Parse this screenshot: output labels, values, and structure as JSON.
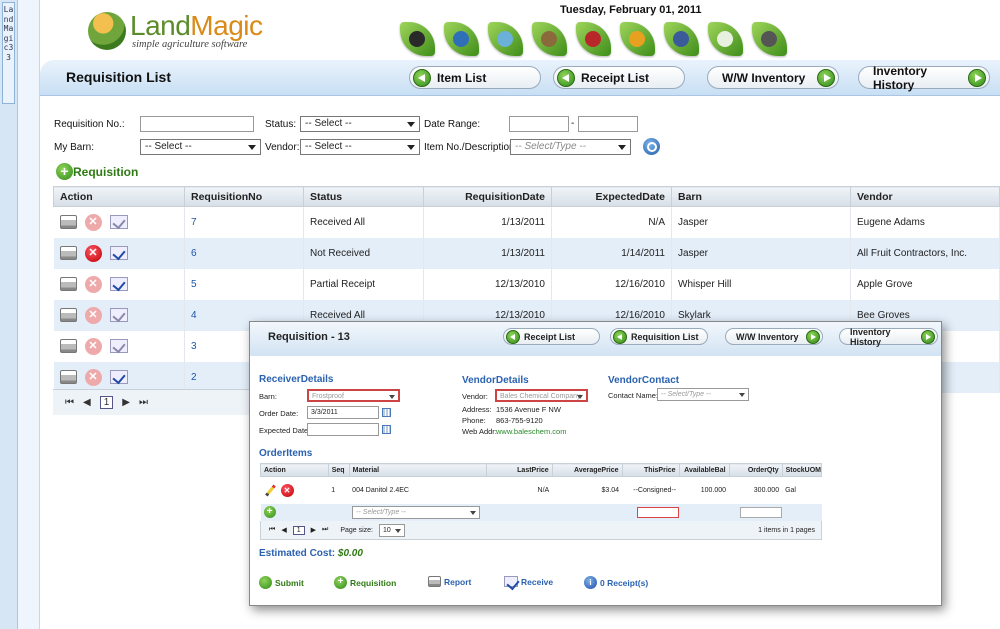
{
  "left_tab": {
    "label": "LandMagic33"
  },
  "logo": {
    "name_a": "Land",
    "name_b": "Magic",
    "tagline": "simple agriculture software"
  },
  "date": "Tuesday, February 01, 2011",
  "nav_icons": [
    "seed-icon",
    "globe-icon",
    "irrigation-icon",
    "field-icon",
    "barn-icon",
    "produce-icon",
    "tablet-icon",
    "money-icon",
    "warehouse-icon"
  ],
  "header": {
    "title": "Requisition List",
    "buttons": {
      "item_list": "Item List",
      "receipt_list": "Receipt List",
      "ww_inventory": "W/W Inventory",
      "inventory_history": "Inventory History"
    }
  },
  "filters": {
    "requisition_no": "Requisition No.:",
    "status": "Status:",
    "status_value": "-- Select --",
    "date_range": "Date Range:",
    "date_sep": "-",
    "my_barn": "My Barn:",
    "barn_value": "-- Select --",
    "vendor": "Vendor:",
    "vendor_value": "-- Select --",
    "item_desc": "Item No./Description:",
    "item_value": "-- Select/Type --"
  },
  "add_requisition": "Requisition",
  "grid": {
    "columns": [
      "Action",
      "RequisitionNo",
      "Status",
      "RequisitionDate",
      "ExpectedDate",
      "Barn",
      "Vendor"
    ],
    "rows": [
      {
        "no": "7",
        "status": "Received All",
        "req_date": "1/13/2011",
        "exp_date": "N/A",
        "barn": "Jasper",
        "vendor": "Eugene Adams"
      },
      {
        "no": "6",
        "status": "Not Received",
        "req_date": "1/13/2011",
        "exp_date": "1/14/2011",
        "barn": "Jasper",
        "vendor": "All Fruit Contractors, Inc."
      },
      {
        "no": "5",
        "status": "Partial Receipt",
        "req_date": "12/13/2010",
        "exp_date": "12/16/2010",
        "barn": "Whisper Hill",
        "vendor": "Apple Grove"
      },
      {
        "no": "4",
        "status": "Received All",
        "req_date": "12/13/2010",
        "exp_date": "12/16/2010",
        "barn": "Skylark",
        "vendor": "Bee Groves"
      },
      {
        "no": "3",
        "status": "",
        "req_date": "",
        "exp_date": "",
        "barn": "",
        "vendor": ""
      },
      {
        "no": "2",
        "status": "",
        "req_date": "",
        "exp_date": "",
        "barn": "",
        "vendor": ""
      }
    ],
    "pager": {
      "current": "1"
    }
  },
  "dialog": {
    "title": "Requisition - 13",
    "buttons": {
      "receipt_list": "Receipt List",
      "requisition_list": "Requisition List",
      "ww_inventory": "W/W Inventory",
      "inventory_history": "Inventory History"
    },
    "receiver": {
      "heading": "ReceiverDetails",
      "barn_label": "Barn:",
      "barn_value": "Frostproof",
      "order_date_label": "Order Date:",
      "order_date_value": "3/3/2011",
      "expected_date_label": "Expected Date:"
    },
    "vendor": {
      "heading": "VendorDetails",
      "vendor_label": "Vendor:",
      "vendor_value": "Bales Chemical Company",
      "address_label": "Address:",
      "address_value": "1536 Avenue F NW",
      "phone_label": "Phone:",
      "phone_value": "863-755-9120",
      "web_label": "Web Addr:",
      "web_value": "www.baleschem.com"
    },
    "contact": {
      "heading": "VendorContact",
      "name_label": "Contact Name:",
      "name_value": "-- Select/Type --"
    },
    "order_items": {
      "heading": "OrderItems",
      "columns": [
        "Action",
        "Seq",
        "Material",
        "LastPrice",
        "AveragePrice",
        "ThisPrice",
        "AvailableBal",
        "OrderQty",
        "StockUOM"
      ],
      "row": {
        "seq": "1",
        "material": "004 Danitol 2.4EC",
        "last_price": "N/A",
        "avg_price": "$3.04",
        "this_price": "--Consigned--",
        "avail": "100.000",
        "qty": "300.000",
        "uom": "Gal"
      },
      "new_row_select": "-- Select/Type --",
      "pager": {
        "current": "1",
        "page_size_label": "Page size:",
        "page_size": "10",
        "summary_a": "1",
        "summary_b": " items in ",
        "summary_c": "1",
        "summary_d": " pages"
      }
    },
    "estimated_label": "Estimated Cost:",
    "estimated_value": "$0.00",
    "footer": {
      "submit": "Submit",
      "requisition": "Requisition",
      "report": "Report",
      "receive": "Receive",
      "receipts": "0 Receipt(s)"
    }
  }
}
